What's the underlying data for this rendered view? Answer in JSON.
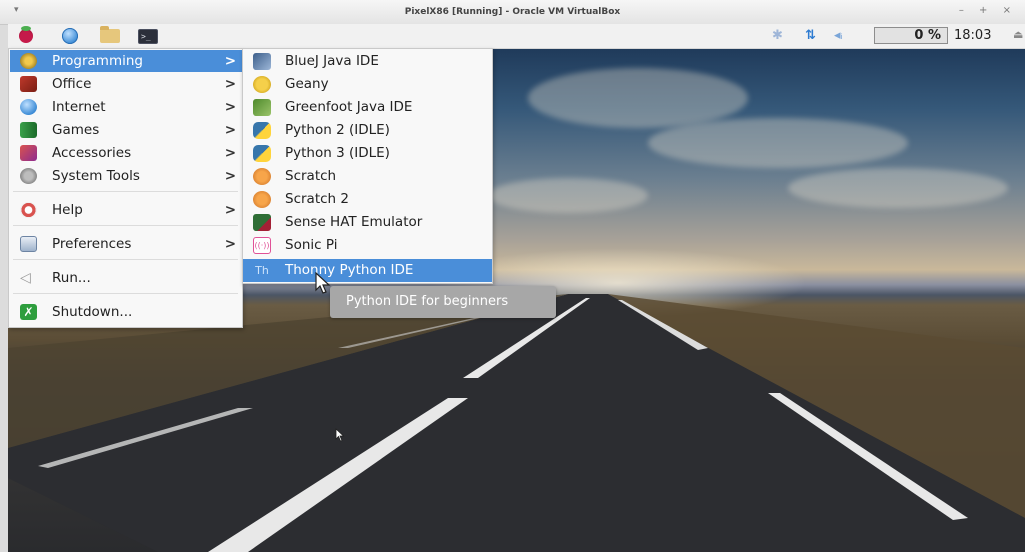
{
  "window": {
    "title": "PixelX86 [Running] - Oracle VM VirtualBox",
    "system_menu": "▾",
    "controls": "– + ×"
  },
  "panel": {
    "launchers": [
      {
        "icon": "raspberry-menu-icon"
      },
      {
        "icon": "web-browser-icon"
      },
      {
        "icon": "file-manager-icon"
      },
      {
        "icon": "terminal-icon"
      }
    ],
    "terminal_glyph": ">_",
    "tray": {
      "bluetooth": "✱",
      "network": "⇅",
      "volume": "◂ᵢ",
      "cpu_value": "0",
      "cpu_unit": "%",
      "clock": "18:03",
      "eject": "⏏"
    }
  },
  "menu": {
    "items": [
      {
        "label": "Programming",
        "has_submenu": true,
        "active": true,
        "icon": "programming-icon"
      },
      {
        "label": "Office",
        "has_submenu": true,
        "icon": "office-icon"
      },
      {
        "label": "Internet",
        "has_submenu": true,
        "icon": "internet-icon"
      },
      {
        "label": "Games",
        "has_submenu": true,
        "icon": "games-icon"
      },
      {
        "label": "Accessories",
        "has_submenu": true,
        "icon": "accessories-icon"
      },
      {
        "label": "System Tools",
        "has_submenu": true,
        "icon": "system-tools-icon"
      },
      {
        "label": "Help",
        "has_submenu": true,
        "icon": "help-icon"
      },
      {
        "label": "Preferences",
        "has_submenu": true,
        "icon": "preferences-icon"
      },
      {
        "label": "Run...",
        "icon": "run-icon"
      },
      {
        "label": "Shutdown...",
        "icon": "shutdown-icon"
      }
    ],
    "arrow": ">"
  },
  "submenu": {
    "items": [
      {
        "label": "BlueJ Java IDE",
        "icon": "bluej-icon"
      },
      {
        "label": "Geany",
        "icon": "geany-icon"
      },
      {
        "label": "Greenfoot Java IDE",
        "icon": "greenfoot-icon"
      },
      {
        "label": "Python 2 (IDLE)",
        "icon": "python-icon"
      },
      {
        "label": "Python 3 (IDLE)",
        "icon": "python-icon"
      },
      {
        "label": "Scratch",
        "icon": "scratch-icon"
      },
      {
        "label": "Scratch 2",
        "icon": "scratch-icon"
      },
      {
        "label": "Sense HAT Emulator",
        "icon": "sense-hat-icon"
      },
      {
        "label": "Sonic Pi",
        "icon": "sonic-pi-icon"
      },
      {
        "label": "Thonny Python IDE",
        "icon": "thonny-icon",
        "active": true
      }
    ]
  },
  "tooltip": {
    "text": "Python IDE for beginners"
  },
  "colors": {
    "highlight": "#4a8ed9",
    "panel": "#f1f1f1",
    "tooltip": "#a7a7a7"
  }
}
